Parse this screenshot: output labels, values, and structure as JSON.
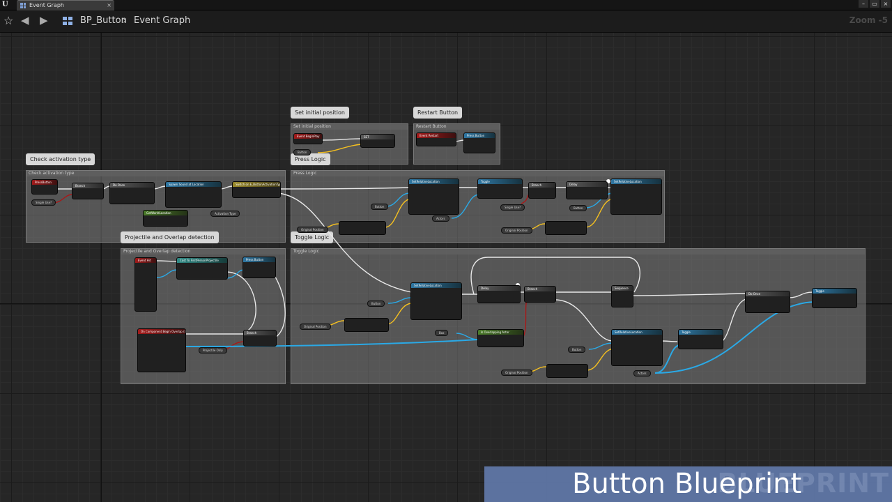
{
  "window": {
    "tab_label": "Event Graph",
    "tab_close": "×",
    "controls": [
      "–",
      "▭",
      "×"
    ]
  },
  "toolbar": {
    "breadcrumb_root": "BP_Button",
    "breadcrumb_separator": "›",
    "breadcrumb_current": "Event Graph",
    "zoom": "Zoom -5"
  },
  "comments": {
    "check_activation": {
      "bubble": "Check activation type",
      "header": "Check activation type"
    },
    "set_initial": {
      "bubble": "Set initial position",
      "header": "Set initial position"
    },
    "restart": {
      "bubble": "Restart Button",
      "header": "Restart Button"
    },
    "press_logic": {
      "bubble": "Press Logic",
      "header": "Press Logic"
    },
    "projectile": {
      "bubble": "Projectile and Overlap detection",
      "header": "Projectile and Overlap detection"
    },
    "toggle_logic": {
      "bubble": "Toggle Logic",
      "header": "Toggle Logic"
    }
  },
  "nodes": {
    "press_button_event": "PressButton",
    "branch": "Branch",
    "do_once": "Do Once",
    "spawn_sound": "Spawn Sound at Location",
    "switch_activation": "Switch on E_ButtonActivationType",
    "get_world_location": "GetWorldLocation",
    "event_begin_play": "Event BeginPlay",
    "set_node": "SET",
    "event_restart": "Event Restart",
    "press_button_call": "Press Button",
    "set_relative_location": "SetRelativeLocation",
    "toggle": "Toggle",
    "delay": "Delay",
    "event_hit": "Event Hit",
    "cast_projectile": "Cast To FirstPersonProjectile",
    "on_component_overlap": "On Component Begin Overlap (Box)",
    "is_overlapping_actor": "Is Overlapping Actor",
    "sequence": "Sequence"
  },
  "variables": {
    "single_use": "Single Use?",
    "activation_type": "Activation Type",
    "button": "Button",
    "original_position": "Original Position",
    "actors": "Actors",
    "projectile_only": "Projectile Only",
    "box": "Box"
  },
  "watermark": {
    "title": "Button Blueprint",
    "bg_text": "BLUEPRINT"
  },
  "colors": {
    "exec_wire": "#e8e8e8",
    "vector_wire": "#f5c020",
    "object_wire": "#2aa9e6",
    "bool_wire": "#a81818",
    "banner": "#5f76a5"
  }
}
